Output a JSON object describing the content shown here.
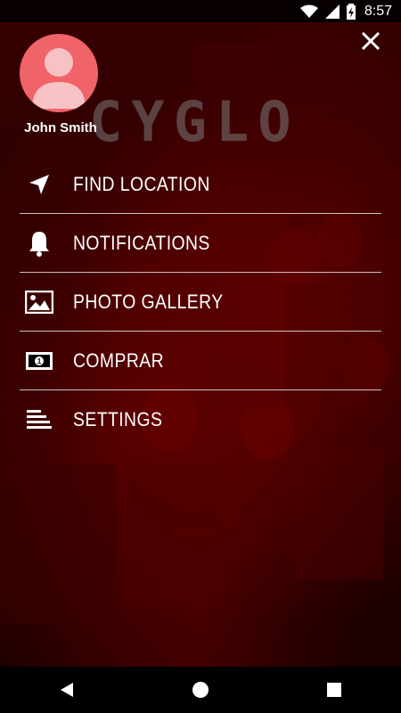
{
  "status_bar": {
    "time": "8:57",
    "icons": [
      "wifi-icon",
      "signal-icon",
      "battery-charging-icon"
    ]
  },
  "drawer": {
    "close_icon": "close-icon",
    "user": {
      "name": "John Smith",
      "avatar_icon": "avatar-person-icon"
    },
    "brand": "CYGLO",
    "menu": [
      {
        "label": "FIND LOCATION",
        "icon": "navigation-arrow-icon"
      },
      {
        "label": "NOTIFICATIONS",
        "icon": "bell-icon"
      },
      {
        "label": "PHOTO GALLERY",
        "icon": "image-icon"
      },
      {
        "label": "COMPRAR",
        "icon": "money-bill-icon"
      },
      {
        "label": "SETTINGS",
        "icon": "list-lines-icon"
      }
    ]
  },
  "nav_bar": {
    "icons": [
      "back-icon",
      "home-icon",
      "recents-icon"
    ]
  },
  "colors": {
    "accent": "#f06469",
    "overlay": "#3a0000",
    "text": "#ffffff"
  }
}
